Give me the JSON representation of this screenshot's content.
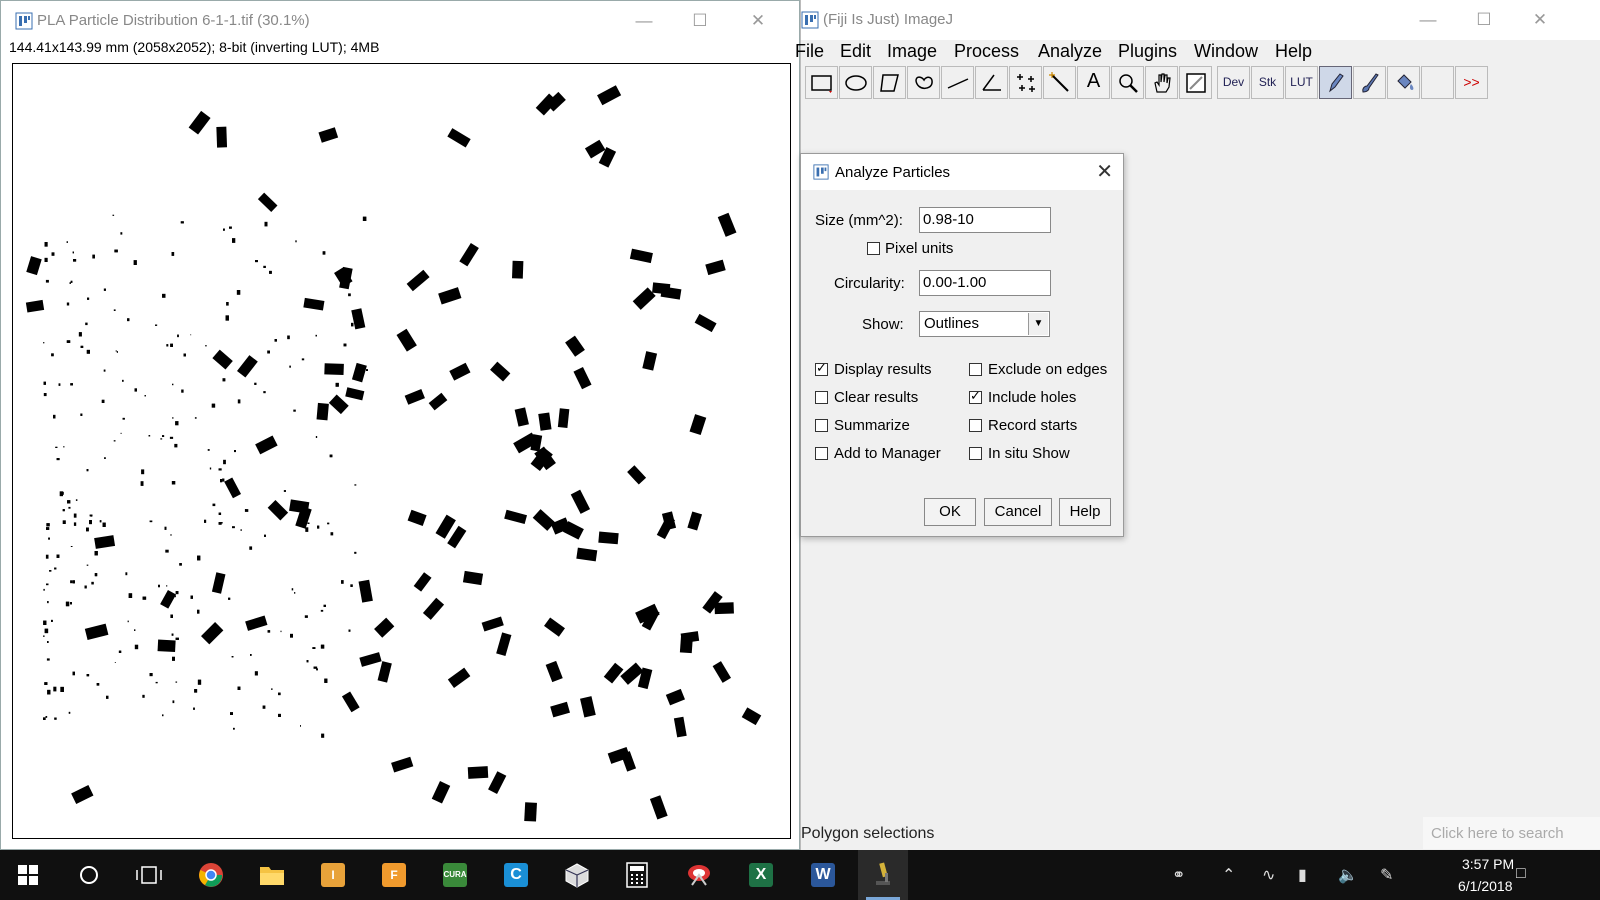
{
  "image_window": {
    "title": "PLA Particle Distribution 6-1-1.tif (30.1%)",
    "info": "144.41x143.99 mm (2058x2052); 8-bit (inverting LUT); 4MB",
    "icons": [
      "imagej-app-icon",
      "minimize-icon",
      "maximize-icon",
      "close-icon"
    ]
  },
  "imagej_window": {
    "title": "(Fiji Is Just) ImageJ",
    "menu": [
      "File",
      "Edit",
      "Image",
      "Process",
      "Analyze",
      "Plugins",
      "Window",
      "Help"
    ],
    "tools": [
      {
        "name": "rectangle-tool-icon"
      },
      {
        "name": "oval-tool-icon"
      },
      {
        "name": "polygon-tool-icon"
      },
      {
        "name": "freehand-tool-icon"
      },
      {
        "name": "line-tool-icon"
      },
      {
        "name": "angle-tool-icon"
      },
      {
        "name": "multipoint-tool-icon"
      },
      {
        "name": "wand-tool-icon"
      },
      {
        "name": "text-tool-icon",
        "label": "A"
      },
      {
        "name": "magnifier-tool-icon"
      },
      {
        "name": "hand-tool-icon"
      },
      {
        "name": "color-picker-tool-icon"
      },
      {
        "name": "dev-tool-icon",
        "label": "Dev"
      },
      {
        "name": "stk-tool-icon",
        "label": "Stk"
      },
      {
        "name": "lut-tool-icon",
        "label": "LUT"
      },
      {
        "name": "pencil-tool-icon"
      },
      {
        "name": "brush-tool-icon"
      },
      {
        "name": "flood-fill-tool-icon"
      },
      {
        "name": "blank-tool-slot"
      },
      {
        "name": "more-tools-icon",
        "label": ">>"
      }
    ],
    "status": "Polygon selections",
    "search_placeholder": "Click here to search"
  },
  "dialog": {
    "title": "Analyze Particles",
    "size_label": "Size (mm^2):",
    "size_value": "0.98-10",
    "pixel_units_label": "Pixel units",
    "pixel_units_checked": false,
    "circularity_label": "Circularity:",
    "circularity_value": "0.00-1.00",
    "show_label": "Show:",
    "show_value": "Outlines",
    "checkboxes": [
      {
        "label": "Display results",
        "checked": true
      },
      {
        "label": "Exclude on edges",
        "checked": false
      },
      {
        "label": "Clear results",
        "checked": false
      },
      {
        "label": "Include holes",
        "checked": true
      },
      {
        "label": "Summarize",
        "checked": false
      },
      {
        "label": "Record starts",
        "checked": false
      },
      {
        "label": "Add to Manager",
        "checked": false
      },
      {
        "label": "In situ Show",
        "checked": false
      }
    ],
    "buttons": {
      "ok": "OK",
      "cancel": "Cancel",
      "help": "Help"
    }
  },
  "taskbar": {
    "apps": [
      {
        "name": "windows-start-icon",
        "running": false
      },
      {
        "name": "cortana-search-icon",
        "running": false
      },
      {
        "name": "task-view-icon",
        "running": false
      },
      {
        "name": "chrome-icon",
        "running": false
      },
      {
        "name": "file-explorer-icon",
        "running": false
      },
      {
        "name": "inventor-icon",
        "running": false
      },
      {
        "name": "fusion360-icon",
        "running": false
      },
      {
        "name": "cura-icon",
        "running": false
      },
      {
        "name": "creo-icon",
        "running": false
      },
      {
        "name": "cube-app-icon",
        "running": false
      },
      {
        "name": "calculator-icon",
        "running": false
      },
      {
        "name": "snipping-tool-icon",
        "running": false
      },
      {
        "name": "excel-icon",
        "running": false
      },
      {
        "name": "word-icon",
        "running": false
      },
      {
        "name": "fiji-microscope-icon",
        "running": true
      }
    ],
    "tray_icons": [
      "people-icon",
      "chevron-up-icon",
      "wifi-icon",
      "battery-icon",
      "volume-icon",
      "pen-icon",
      "notification-icon"
    ],
    "time": "3:57 PM",
    "date": "6/1/2018"
  },
  "colors": {
    "accent": "#0078d7",
    "taskbar": "#101010",
    "particle": "#000000"
  }
}
